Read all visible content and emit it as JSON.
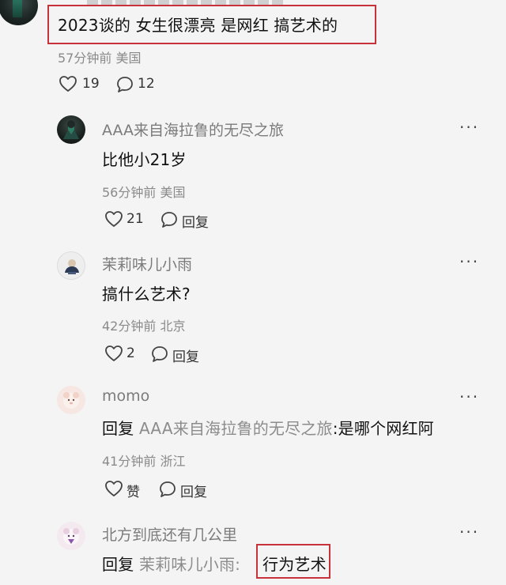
{
  "top_comment": {
    "text": "2023谈的 女生很漂亮 是网红 搞艺术的",
    "time_location": "57分钟前 美国",
    "likes": "19",
    "replies": "12"
  },
  "replies": [
    {
      "username": "AAA来自海拉鲁的无尽之旅",
      "text": "比他小21岁",
      "time_location": "56分钟前 美国",
      "likes": "21",
      "reply_label": "回复"
    },
    {
      "username": "茉莉味儿小雨",
      "text": "搞什么艺术?",
      "time_location": "42分钟前 北京",
      "likes": "2",
      "reply_label": "回复"
    },
    {
      "username": "momo",
      "reply_prefix": "回复",
      "reply_target": "AAA来自海拉鲁的无尽之旅",
      "text": ":是哪个网红阿",
      "time_location": "41分钟前 浙江",
      "likes": "赞",
      "reply_label": "回复"
    },
    {
      "username": "北方到底还有几公里",
      "reply_prefix": "回复",
      "reply_target": "茉莉味儿小雨",
      "separator": ":",
      "text": "行为艺术"
    }
  ],
  "more_label": "···",
  "colors": {
    "highlight": "#c8323a",
    "meta_gray": "#8a8a8a",
    "background": "#f4f4f4"
  },
  "icons": [
    "heart-icon",
    "comment-icon",
    "more-icon",
    "avatar"
  ]
}
